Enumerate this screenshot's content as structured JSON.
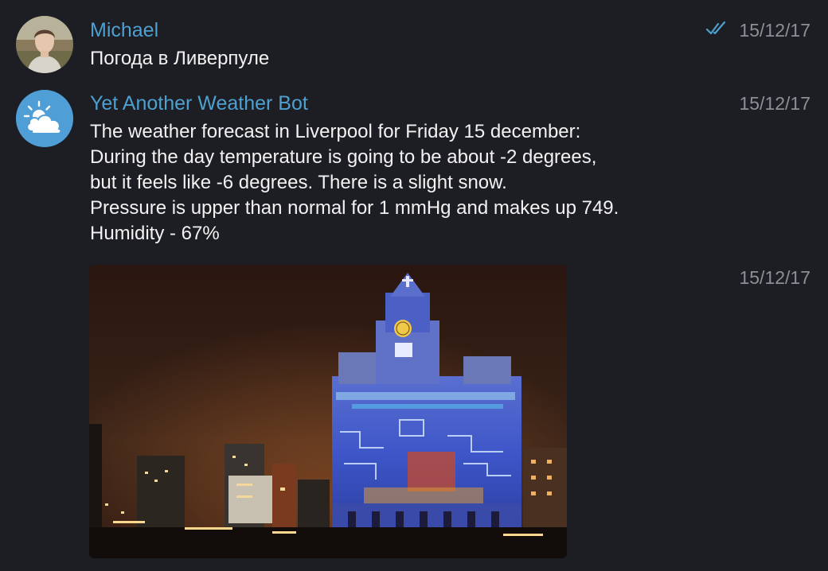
{
  "messages": [
    {
      "sender": "Michael",
      "avatar": "user-photo-avatar",
      "text": [
        "Погода в Ливерпуле"
      ],
      "time": "15/12/17",
      "status_icon": "double-check-icon"
    },
    {
      "sender": "Yet Another Weather Bot",
      "avatar": "partly-cloudy-icon",
      "text": [
        "The weather forecast in Liverpool for Friday 15 december:",
        "During the day temperature is going to be about -2 degrees,",
        "but it feels like -6 degrees. There is a slight snow.",
        "Pressure is upper than normal for 1 mmHg and makes up 749.",
        "Humidity - 67%"
      ],
      "time": "15/12/17"
    },
    {
      "attachment": "photo",
      "time": "15/12/17"
    }
  ],
  "colors": {
    "background": "#1d1d24",
    "sender_name": "#4da0cf",
    "message_text": "#f2f2f2",
    "timestamp": "#8e8e95",
    "bot_avatar": "#4f9fd6",
    "read_ticks": "#4da0cf"
  }
}
